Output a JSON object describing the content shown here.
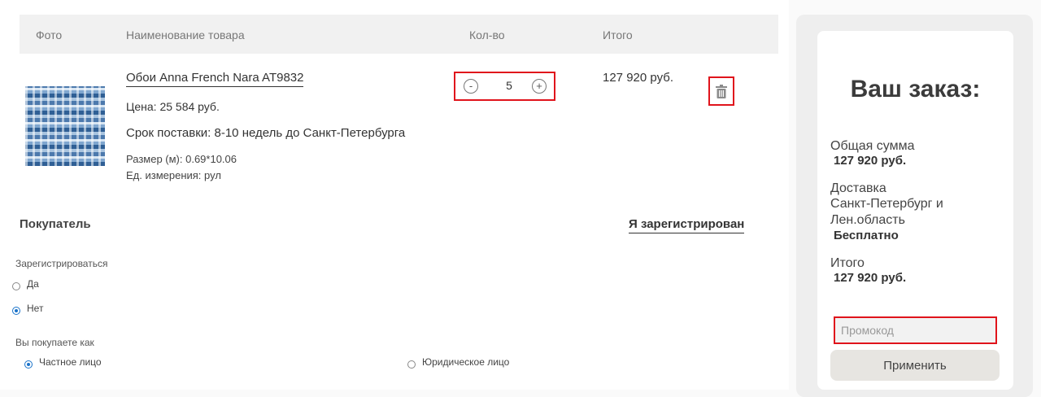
{
  "table_header": {
    "photo": "Фото",
    "name": "Наименование товара",
    "qty": "Кол-во",
    "total": "Итого"
  },
  "item": {
    "name": "Обои Anna French Nara AT9832",
    "price": "Цена: 25 584 руб.",
    "delivery": "Срок поставки: 8-10 недель до Санкт-Петербурга",
    "size": "Размер (м): 0.69*10.06",
    "unit": "Ед. измерения: рул",
    "qty_minus": "-",
    "qty_value": "5",
    "qty_plus": "+",
    "total": "127 920 руб.",
    "delete_icon": "trash-icon"
  },
  "buyer": {
    "title": "Покупатель",
    "registered_link": "Я зарегистрирован",
    "register_label": "Зарегистрироваться",
    "register_yes": "Да",
    "register_no": "Нет",
    "register_selected": "Нет",
    "buyer_type_label": "Вы покупаете как",
    "individual": "Частное лицо",
    "legal": "Юридическое лицо",
    "buyer_type_selected": "Частное лицо"
  },
  "order": {
    "title": "Ваш заказ:",
    "sum_label": "Общая сумма",
    "sum_value": "127 920 руб.",
    "delivery_label": "Доставка",
    "delivery_region_1": "Санкт-Петербург и",
    "delivery_region_2": "Лен.область",
    "delivery_value": "Бесплатно",
    "total_label": "Итого",
    "total_value": "127 920 руб.",
    "promo_placeholder": "Промокод",
    "apply_label": "Применить"
  },
  "colors": {
    "highlight": "#e0141c",
    "radio_selected": "#1a73c9",
    "apply_button": "#e7e5e1"
  }
}
